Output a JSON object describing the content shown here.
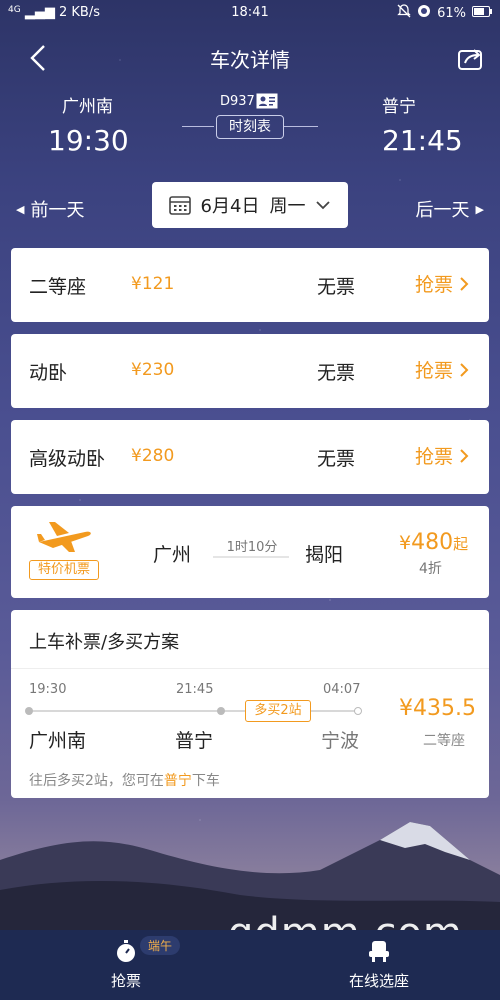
{
  "status_bar": {
    "network": "4G",
    "speed": "2 KB/s",
    "time": "18:41",
    "battery": "61%"
  },
  "header": {
    "title": "车次详情"
  },
  "route": {
    "from_station": "广州南",
    "from_time": "19:30",
    "to_station": "普宁",
    "to_time": "21:45",
    "train_no": "D937",
    "timetable_label": "时刻表"
  },
  "date_nav": {
    "prev": "前一天",
    "next": "后一天",
    "date": "6月4日",
    "weekday": "周一"
  },
  "seats": [
    {
      "name": "二等座",
      "price": "¥121",
      "availability": "无票",
      "action": "抢票"
    },
    {
      "name": "动卧",
      "price": "¥230",
      "availability": "无票",
      "action": "抢票"
    },
    {
      "name": "高级动卧",
      "price": "¥280",
      "availability": "无票",
      "action": "抢票"
    }
  ],
  "flight": {
    "tag": "特价机票",
    "from": "广州",
    "duration": "1时10分",
    "to": "揭阳",
    "price_prefix": "¥",
    "price": "480",
    "price_suffix": "起",
    "discount": "4折"
  },
  "plan": {
    "title": "上车补票/多买方案",
    "stops": [
      {
        "time": "19:30",
        "station": "广州南"
      },
      {
        "time": "21:45",
        "station": "普宁"
      },
      {
        "time": "04:07",
        "station": "宁波"
      }
    ],
    "badge": "多买2站",
    "price": "¥435.5",
    "seat_type": "二等座",
    "note_prefix": "往后多买2站，您可在",
    "note_station": "普宁",
    "note_suffix": "下车"
  },
  "bottom_nav": {
    "tab1": "抢票",
    "tab1_badge": "端午",
    "tab2": "在线选座"
  },
  "watermark": "gdmm.com",
  "colors": {
    "accent": "#f29a1f",
    "bottom_bar": "#1e2a52"
  }
}
